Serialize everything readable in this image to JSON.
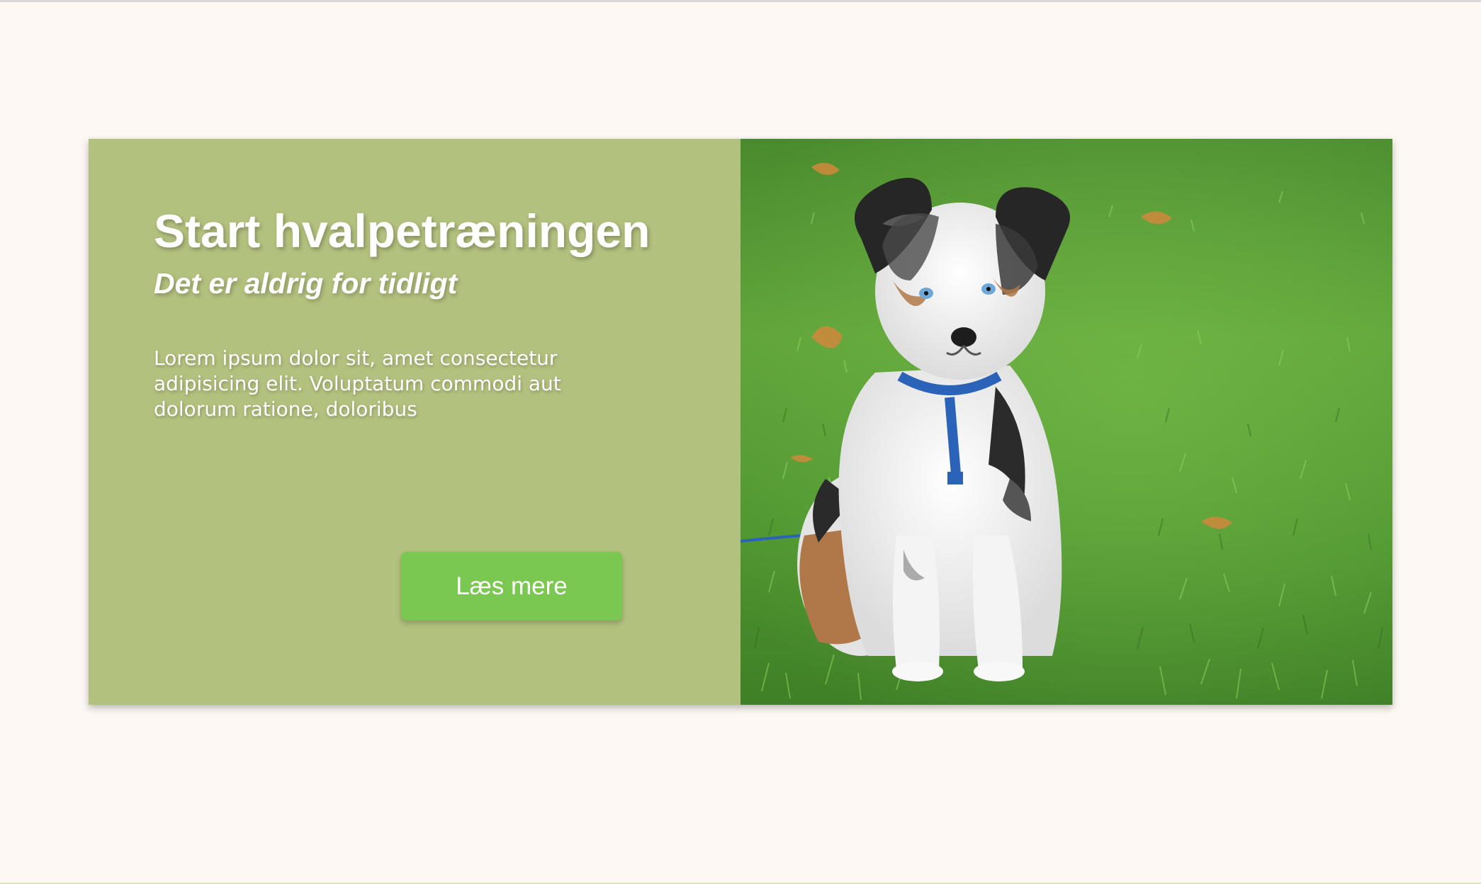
{
  "hero": {
    "title": "Start hvalpetræningen",
    "subtitle": "Det er aldrig for tidligt",
    "body": "Lorem ipsum dolor sit, amet consectetur adipisicing elit. Voluptatum commodi aut dolorum ratione, doloribus",
    "button_label": "Læs mere",
    "image_subject": "puppy-on-grass-photo"
  },
  "colors": {
    "page_background": "#fdf8f4",
    "panel_background": "#b3c17e",
    "button_background": "#7ac851",
    "text": "#ffffff"
  }
}
